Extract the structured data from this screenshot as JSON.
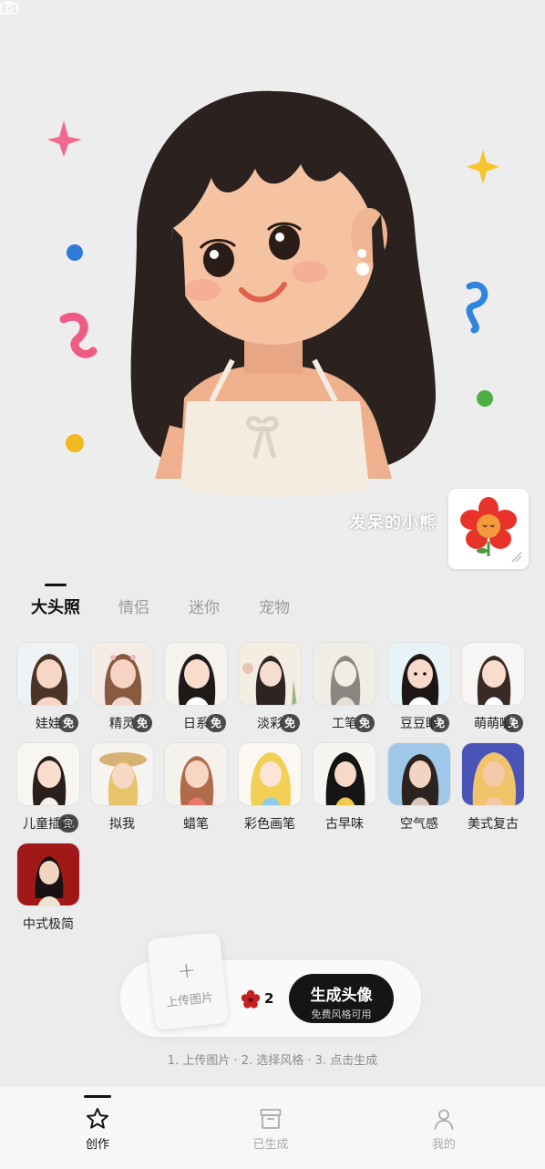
{
  "hero": {
    "signature": "发呆的小熊"
  },
  "tabs": [
    {
      "label": "大头照",
      "active": true
    },
    {
      "label": "情侣",
      "active": false
    },
    {
      "label": "迷你",
      "active": false
    },
    {
      "label": "宠物",
      "active": false
    }
  ],
  "styles": [
    {
      "label": "娃娃",
      "free": true,
      "badge": "免"
    },
    {
      "label": "精灵",
      "free": true,
      "badge": "免"
    },
    {
      "label": "日系",
      "free": true,
      "badge": "免"
    },
    {
      "label": "淡彩",
      "free": true,
      "badge": "免"
    },
    {
      "label": "工笔",
      "free": true,
      "badge": "免"
    },
    {
      "label": "豆豆眼",
      "free": true,
      "badge": "免"
    },
    {
      "label": "萌萌哒",
      "free": true,
      "badge": "免"
    },
    {
      "label": "儿童插画",
      "free": true,
      "badge": "免"
    },
    {
      "label": "拟我",
      "free": false
    },
    {
      "label": "蜡笔",
      "free": false
    },
    {
      "label": "彩色画笔",
      "free": false
    },
    {
      "label": "古早味",
      "free": false
    },
    {
      "label": "空气感",
      "free": false
    },
    {
      "label": "美式复古",
      "free": false
    },
    {
      "label": "中式极简",
      "free": false
    }
  ],
  "action": {
    "upload_plus": "+",
    "upload_label": "上传图片",
    "credit_count": "2",
    "generate_title": "生成头像",
    "generate_subtitle": "免费风格可用",
    "steps": "1. 上传图片 · 2. 选择风格 · 3. 点击生成"
  },
  "nav": [
    {
      "label": "创作",
      "icon": "star-icon",
      "active": true
    },
    {
      "label": "已生成",
      "icon": "archive-box-icon",
      "active": false
    },
    {
      "label": "我的",
      "icon": "person-icon",
      "active": false
    }
  ],
  "colors": {
    "accent": "#151515",
    "credit_flower": "#c8201e",
    "free_badge": "#4a4a4a"
  }
}
